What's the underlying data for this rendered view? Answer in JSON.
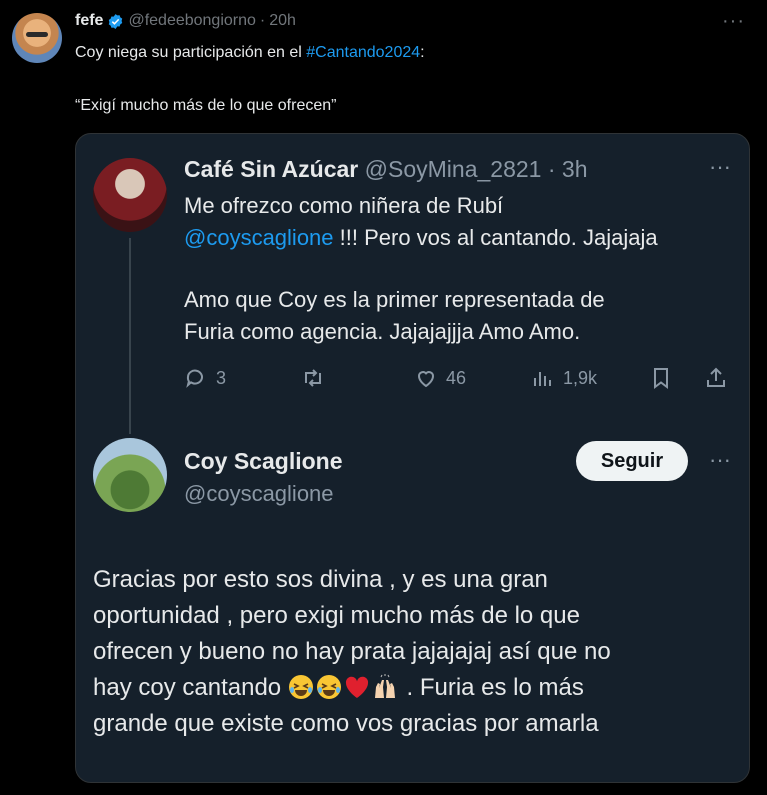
{
  "outer_tweet": {
    "author_name": "fefe",
    "handle": "@fedeebongiorno",
    "separator": "·",
    "time": "20h",
    "text_before_link": "Coy niega su participación en el ",
    "hashtag": "#Cantando2024",
    "text_after_link": ":",
    "quote_text": "“Exigí mucho más de lo que ofrecen”",
    "more_label": "···"
  },
  "quoted_tweet": {
    "author_name": "Café Sin Azúcar",
    "handle": "@SoyMina_2821",
    "separator": "·",
    "time": "3h",
    "more_label": "···",
    "line1": "Me ofrezco como niñera de Rubí",
    "mention": "@coyscaglione",
    "line2_rest": " !!! Pero vos al cantando. Jajajaja",
    "paragraph2_line1": "Amo que Coy es la primer representada de",
    "paragraph2_line2": "Furia como agencia. Jajajajjja Amo Amo.",
    "actions": {
      "replies": "3",
      "likes": "46",
      "views": "1,9k"
    }
  },
  "reply_tweet": {
    "author_name": "Coy Scaglione",
    "handle": "@coyscaglione",
    "follow_label": "Seguir",
    "more_label": "···",
    "line1": "Gracias por esto sos divina , y es una gran",
    "line2": "oportunidad , pero exigi mucho más de lo que",
    "line3": "ofrecen y bueno no hay prata jajajajaj así que no",
    "line4_start": "hay coy cantando ",
    "line4_end": " . Furia es lo más",
    "line5": "grande que existe como vos gracias por amarla"
  },
  "colors": {
    "background": "#000000",
    "card": "#15202b",
    "text": "#e7e9ea",
    "muted": "#71767b",
    "link": "#1d9bf0"
  },
  "icons": [
    "verified-badge-icon",
    "more-icon",
    "reply-icon",
    "retweet-icon",
    "like-icon",
    "views-icon",
    "bookmark-icon",
    "share-icon",
    "laughing-emoji-icon",
    "heart-emoji-icon",
    "raised-hands-emoji-icon"
  ]
}
